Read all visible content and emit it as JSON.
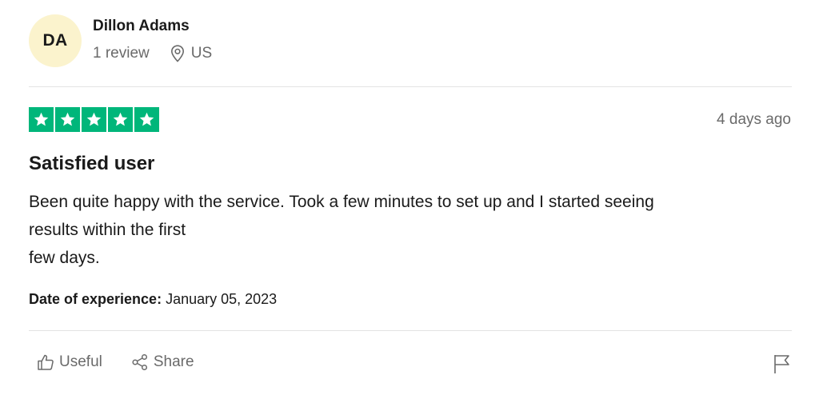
{
  "consumer": {
    "initials": "DA",
    "name": "Dillon Adams",
    "review_count": "1 review",
    "country": "US",
    "avatar_color": "#fbf3cd"
  },
  "review": {
    "rating": 5,
    "star_color": "#00b67a",
    "date": "4 days ago",
    "title": "Satisfied user",
    "body_lines": [
      "Been quite happy with the service. Took a few minutes to set up and I started seeing",
      "results within the first",
      "few days."
    ],
    "experience_label": "Date of experience:",
    "experience_date": "January 05, 2023"
  },
  "actions": {
    "useful_label": "Useful",
    "share_label": "Share",
    "useful_icon": "thumbs-up-icon",
    "share_icon": "share-icon",
    "report_icon": "flag-icon"
  }
}
